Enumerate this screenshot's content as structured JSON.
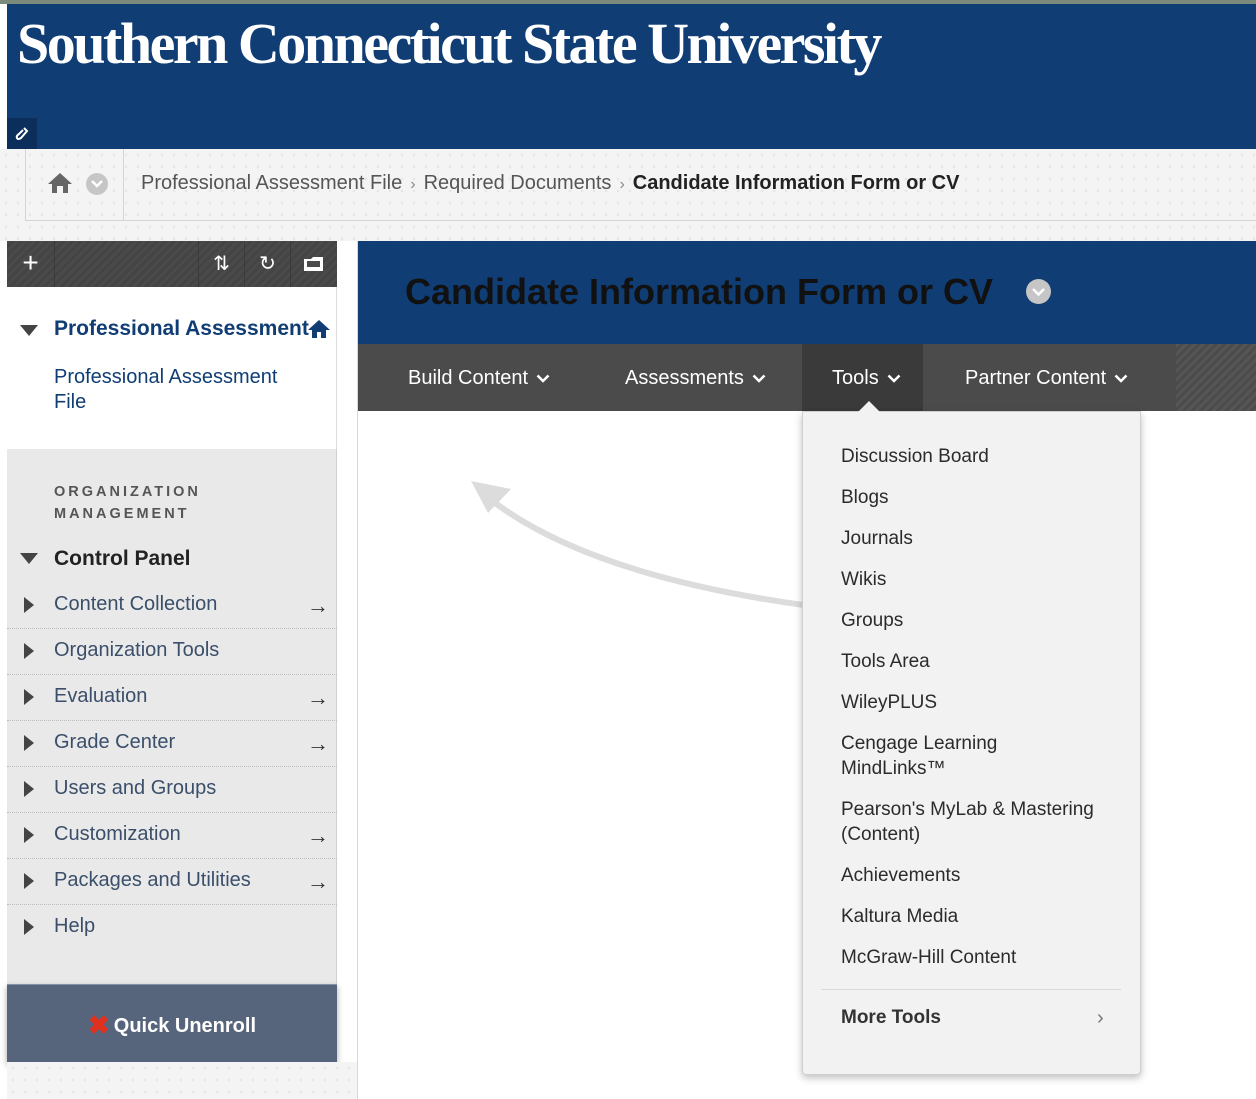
{
  "header": {
    "university_name": "Southern Connecticut State University",
    "link_icon": "link-icon"
  },
  "breadcrumb": {
    "items": [
      "Professional Assessment File",
      "Required Documents",
      "Candidate Information Form or CV"
    ],
    "separator": "›"
  },
  "left_panel": {
    "toolbar": {
      "add": "+",
      "sort": "⇅",
      "refresh": "↻",
      "folder": "folder-icon"
    },
    "course": {
      "title": "Professional Assessment",
      "link": "Professional Assessment File"
    },
    "management": {
      "section_label": "ORGANIZATION MANAGEMENT",
      "control_panel_title": "Control Panel",
      "items": [
        {
          "label": "Content Collection",
          "arrow": "→"
        },
        {
          "label": "Organization Tools",
          "arrow": ""
        },
        {
          "label": "Evaluation",
          "arrow": "→"
        },
        {
          "label": "Grade Center",
          "arrow": "→"
        },
        {
          "label": "Users and Groups",
          "arrow": ""
        },
        {
          "label": "Customization",
          "arrow": "→"
        },
        {
          "label": "Packages and Utilities",
          "arrow": "→"
        },
        {
          "label": "Help",
          "arrow": ""
        }
      ]
    },
    "quick_unenroll": {
      "icon": "✖",
      "label": "Quick Unenroll"
    }
  },
  "content": {
    "page_title": "Candidate Information Form or CV",
    "action_bar": {
      "build_content": "Build Content",
      "assessments": "Assessments",
      "tools": "Tools",
      "partner_content": "Partner Content"
    },
    "tools_menu": {
      "items": [
        "Discussion Board",
        "Blogs",
        "Journals",
        "Wikis",
        "Groups",
        "Tools Area",
        "WileyPLUS",
        "Cengage Learning",
        "MindLinks™",
        "Pearson's MyLab & Mastering",
        "(Content)",
        "Achievements",
        "Kaltura Media",
        "McGraw-Hill Content"
      ],
      "more_tools": "More Tools",
      "more_chevron": "›"
    }
  },
  "colors": {
    "header_blue": "#0f3d74",
    "action_bar_gray": "#4b4b4b",
    "quick_unenroll_bg": "#56657c",
    "unenroll_red": "#e0301e"
  }
}
